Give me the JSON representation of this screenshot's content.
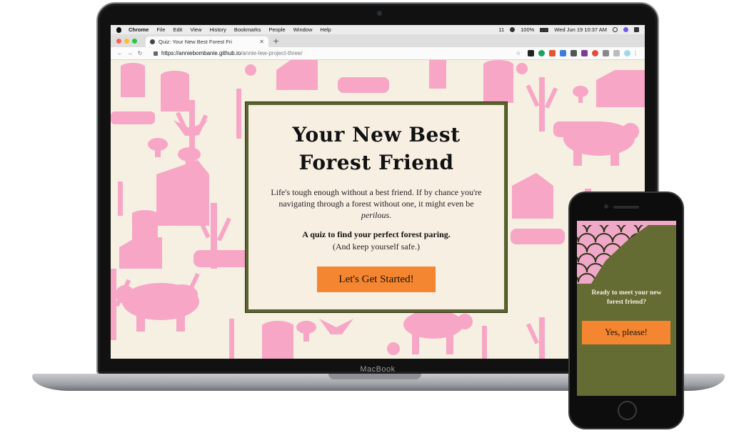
{
  "laptop": {
    "brand_label": "MacBook",
    "menubar": {
      "app": "Chrome",
      "items": [
        "File",
        "Edit",
        "View",
        "History",
        "Bookmarks",
        "People",
        "Window",
        "Help"
      ],
      "status": {
        "notifications": "11",
        "battery": "100%",
        "datetime": "Wed Jun 19  10:37 AM"
      }
    },
    "browser": {
      "tab_title": "Quiz: Your New Best Forest Fri",
      "new_tab": "+",
      "url_host": "https://anniebombanie.github.io",
      "url_path": "/annie-lew-project-three/",
      "traffic_colors": [
        "#fd5f57",
        "#febc2e",
        "#28c840"
      ]
    },
    "quiz": {
      "title_line1": "Your New Best",
      "title_line2": "Forest Friend",
      "intro_text": "Life's tough enough without a best friend. If by chance you're navigating through a forest without one, it might even be ",
      "intro_emphasis": "perilous",
      "intro_end": ".",
      "tagline": "A quiz to find your perfect forest paring.",
      "note": "(And keep yourself safe.)",
      "start_button": "Let's Get Started!"
    },
    "colors": {
      "pattern_pink": "#f7a6c6",
      "background_cream": "#f6f0e2",
      "card_border": "#5c6330",
      "button_orange": "#f58631"
    }
  },
  "phone": {
    "question": "Ready to meet your new forest friend?",
    "button": "Yes, please!",
    "colors": {
      "background_olive": "#646b33",
      "scale_pink": "#f0a8c8"
    }
  }
}
